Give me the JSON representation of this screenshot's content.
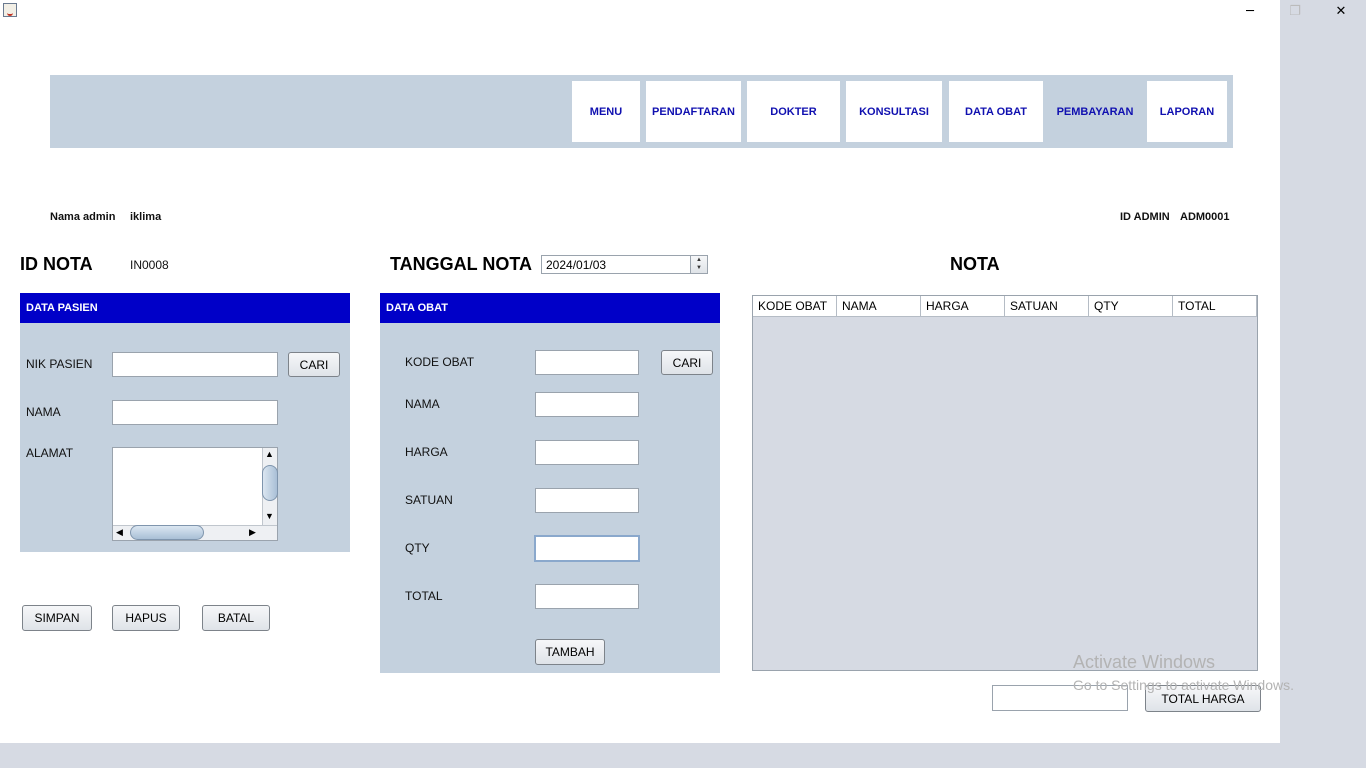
{
  "window": {
    "icon": "java-app-icon",
    "controls": {
      "minimize": "─",
      "restore": "❐",
      "close": "✕"
    }
  },
  "nav": {
    "items": [
      {
        "label": "MENU"
      },
      {
        "label": "PENDAFTARAN"
      },
      {
        "label": "DOKTER"
      },
      {
        "label": "KONSULTASI"
      },
      {
        "label": "DATA OBAT"
      },
      {
        "label": "PEMBAYARAN"
      },
      {
        "label": "LAPORAN"
      }
    ],
    "active": "PEMBAYARAN"
  },
  "admin": {
    "name_label": "Nama admin",
    "name_value": "iklima",
    "id_label": "ID ADMIN",
    "id_value": "ADM0001"
  },
  "nota": {
    "id_label": "ID NOTA",
    "id_value": "IN0008",
    "date_label": "TANGGAL NOTA",
    "date_value": "2024/01/03",
    "title": "NOTA"
  },
  "pasien": {
    "header": "DATA PASIEN",
    "nik_label": "NIK PASIEN",
    "nik_value": "",
    "cari": "CARI",
    "nama_label": "NAMA",
    "nama_value": "",
    "alamat_label": "ALAMAT",
    "alamat_value": ""
  },
  "actions": {
    "simpan": "SIMPAN",
    "hapus": "HAPUS",
    "batal": "BATAL"
  },
  "obat": {
    "header": "DATA OBAT",
    "kode_label": "KODE OBAT",
    "cari": "CARI",
    "nama_label": "NAMA",
    "harga_label": "HARGA",
    "satuan_label": "SATUAN",
    "qty_label": "QTY",
    "total_label": "TOTAL",
    "tambah": "TAMBAH"
  },
  "table": {
    "columns": [
      "KODE OBAT",
      "NAMA",
      "HARGA",
      "SATUAN",
      "QTY",
      "TOTAL"
    ],
    "rows": []
  },
  "total": {
    "value": "",
    "button": "TOTAL HARGA"
  },
  "watermark": {
    "line1": "Activate Windows",
    "line2": "Go to Settings to activate Windows."
  }
}
